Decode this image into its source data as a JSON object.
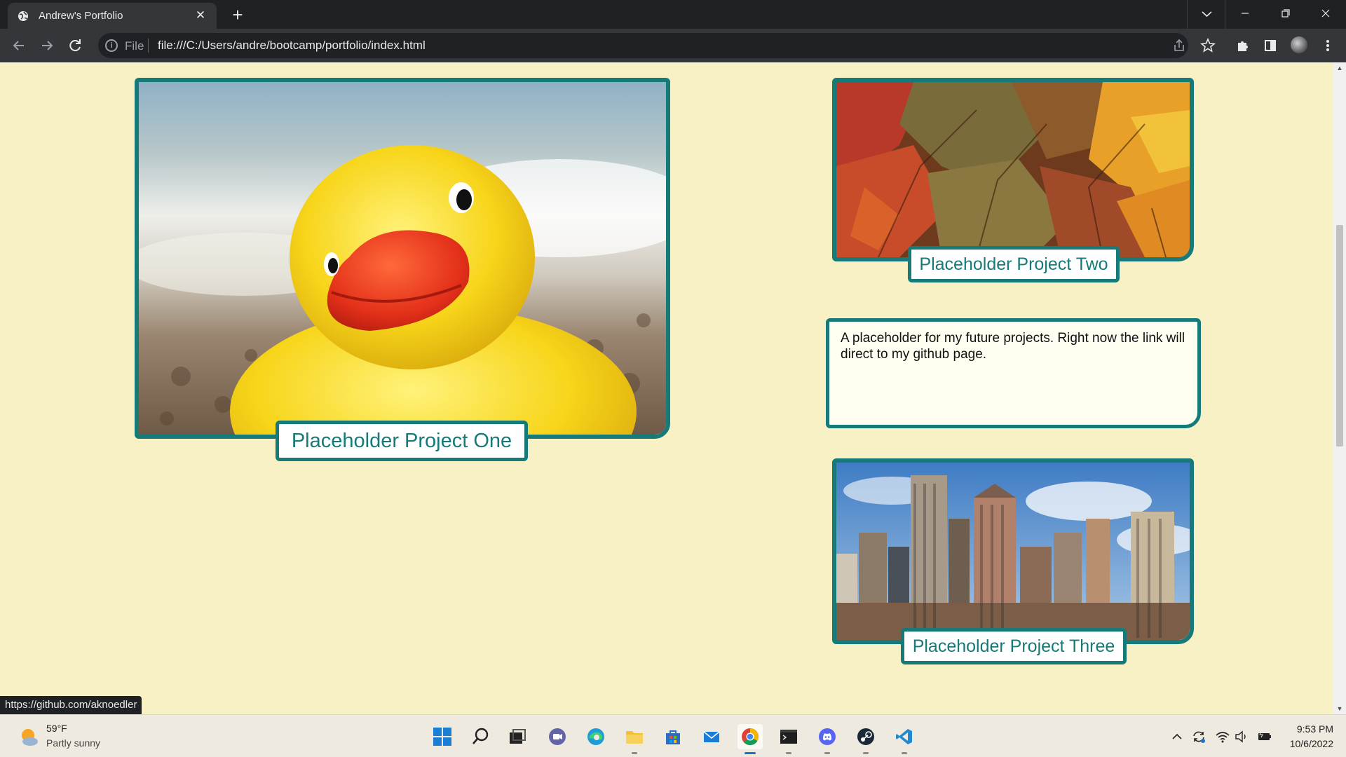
{
  "browser": {
    "tab_title": "Andrew's Portfolio",
    "tab_close": "✕",
    "new_tab": "+",
    "file_label": "File",
    "url": "file:///C:/Users/andre/bootcamp/portfolio/index.html",
    "status_url": "https://github.com/aknoedler"
  },
  "projects": [
    {
      "title": "Placeholder Project One",
      "image": "rubber-duck-photo"
    },
    {
      "title": "Placeholder Project Two",
      "image": "autumn-leaves-photo"
    },
    {
      "title": "Placeholder Project Three",
      "image": "city-skyline-photo"
    }
  ],
  "description": "A placeholder for my future projects. Right now the link will direct to my github page.",
  "taskbar": {
    "weather_temp": "59°F",
    "weather_desc": "Partly sunny",
    "time": "9:53 PM",
    "date": "10/6/2022",
    "apps": [
      "windows-start",
      "search",
      "task-view",
      "teams-chat",
      "edge",
      "file-explorer",
      "microsoft-store",
      "mail",
      "chrome",
      "terminal",
      "discord",
      "steam",
      "vscode"
    ]
  },
  "colors": {
    "page_background": "#f8f1c6",
    "accent_teal": "#167b78",
    "chrome_dark": "#202124",
    "chrome_toolbar": "#35363a"
  }
}
